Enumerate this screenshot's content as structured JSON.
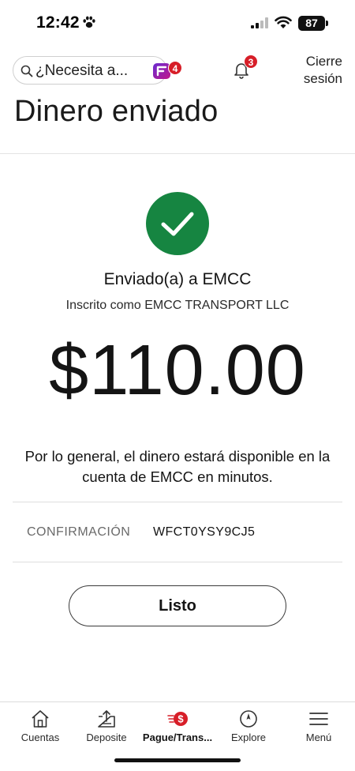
{
  "status_bar": {
    "time": "12:42",
    "battery": "87",
    "icons": [
      "paw-icon",
      "signal-icon",
      "wifi-icon",
      "battery-icon"
    ]
  },
  "header": {
    "search_placeholder": "¿Necesita a...",
    "assistant_badge": "4",
    "notifications_badge": "3",
    "signout_label_line1": "Cierre",
    "signout_label_line2": "sesión",
    "icons": [
      "search-icon",
      "fargo-assistant-icon",
      "bell-icon"
    ]
  },
  "page": {
    "title": "Dinero enviado"
  },
  "confirmation": {
    "sent_to": "Enviado(a) a EMCC",
    "enrolled_as": "Inscrito como EMCC TRANSPORT LLC",
    "amount": "$110.00",
    "availability_note": "Por lo general, el dinero estará disponible en la cuenta de EMCC en minutos.",
    "label": "CONFIRMACIÓN",
    "code": "WFCT0YSY9CJ5",
    "done_button": "Listo"
  },
  "bottom_nav": {
    "items": [
      {
        "label": "Cuentas",
        "icon": "home-icon",
        "active": false
      },
      {
        "label": "Deposite",
        "icon": "deposit-icon",
        "active": false
      },
      {
        "label": "Pague/Trans...",
        "icon": "pay-transfer-icon",
        "active": true
      },
      {
        "label": "Explore",
        "icon": "compass-icon",
        "active": false
      },
      {
        "label": "Menú",
        "icon": "menu-icon",
        "active": false
      }
    ]
  },
  "colors": {
    "success_green": "#168541",
    "badge_red": "#d71e28",
    "text": "#141414"
  }
}
